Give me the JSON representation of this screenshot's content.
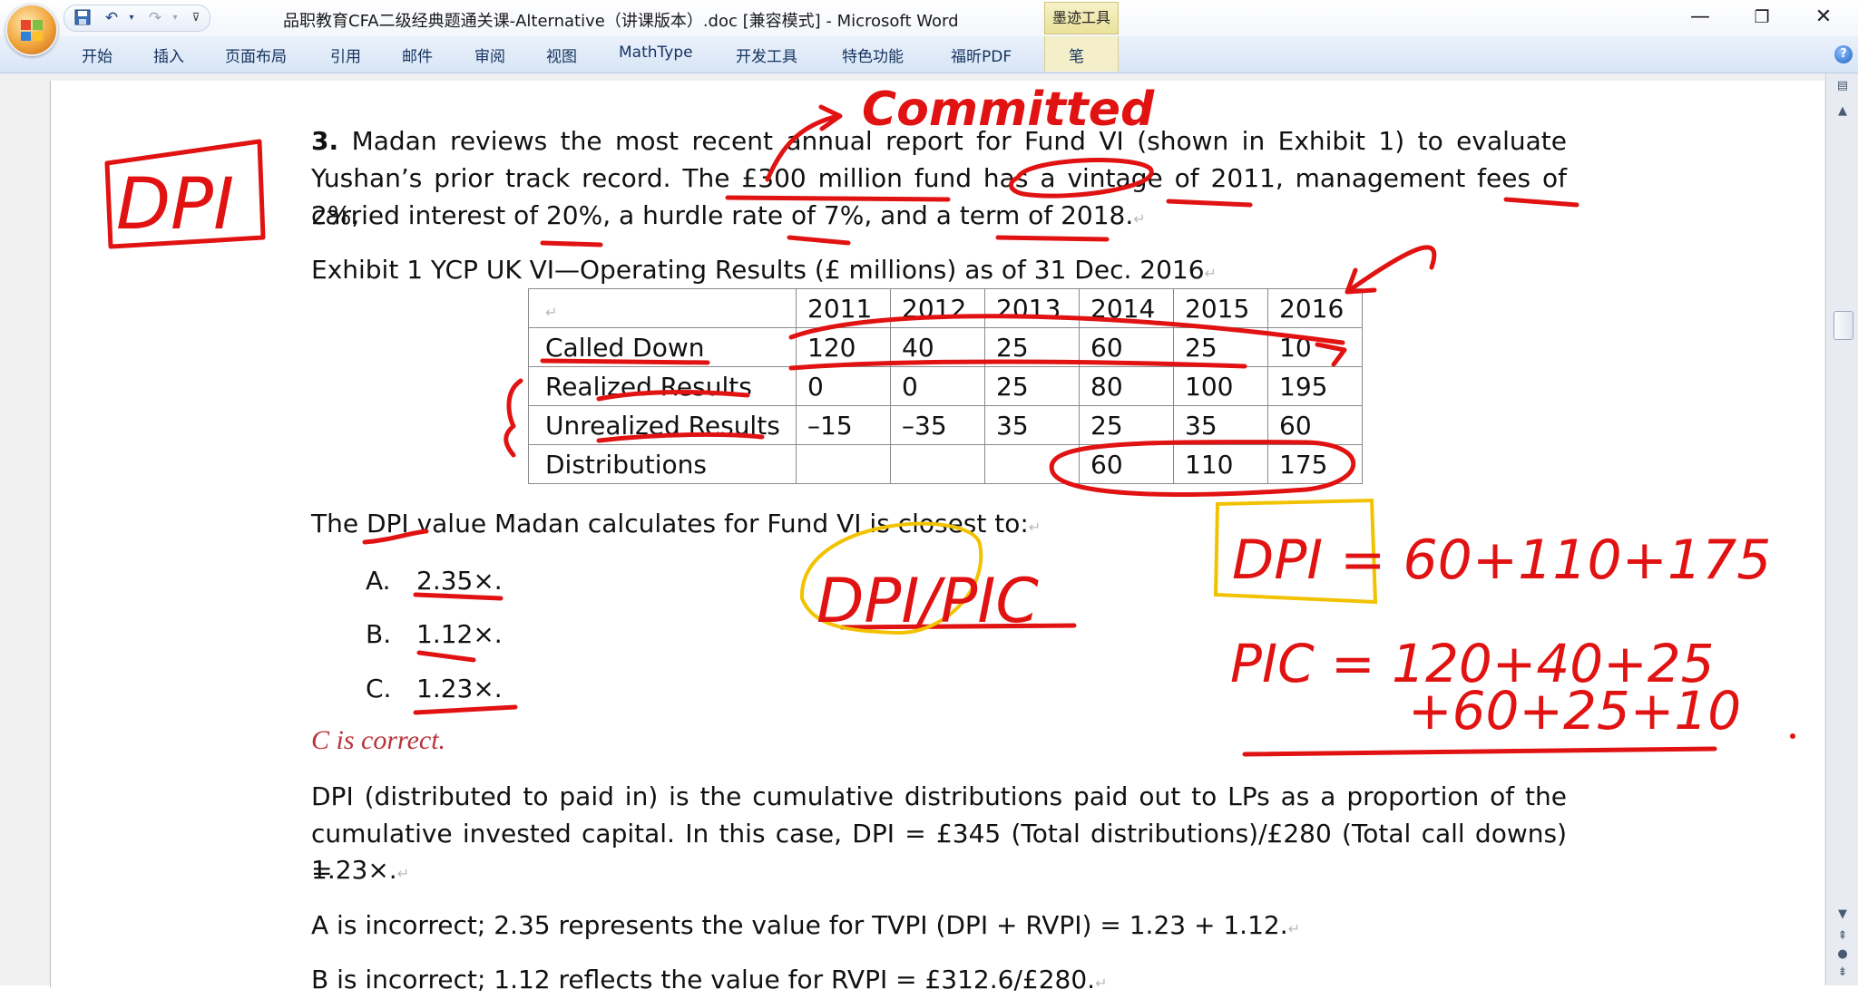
{
  "titlebar": {
    "document_title": "品职教育CFA二级经典题通关课-Alternative（讲课版本）.doc [兼容模式] - Microsoft Word",
    "contextual_tab_group": "墨迹工具",
    "icons": [
      "office-button-icon",
      "save-icon",
      "undo-icon",
      "redo-icon",
      "customize-qat-icon",
      "minimize-icon",
      "restore-icon",
      "close-icon"
    ]
  },
  "ribbon": {
    "tabs": [
      "开始",
      "插入",
      "页面布局",
      "引用",
      "邮件",
      "审阅",
      "视图",
      "MathType",
      "开发工具",
      "特色功能",
      "福昕PDF",
      "笔"
    ]
  },
  "document": {
    "question": {
      "number": "3.",
      "line1": "Madan reviews the most recent annual report for Fund VI (shown in Exhibit 1) to evaluate",
      "line2": "Yushan’s prior track record. The £300 million fund has a vintage of 2011, management fees of 2%,",
      "line3": "carried interest of 20%, a hurdle rate of 7%, and a term of 2018."
    },
    "exhibit_caption": "Exhibit 1 YCP UK VI—Operating Results (£ millions) as of 31 Dec. 2016",
    "exhibit_table": {
      "columns": [
        "",
        "2011",
        "2012",
        "2013",
        "2014",
        "2015",
        "2016"
      ],
      "rows": [
        {
          "label": "Called Down",
          "values": [
            "120",
            "40",
            "25",
            "60",
            "25",
            "10"
          ]
        },
        {
          "label": "Realized Results",
          "values": [
            "0",
            "0",
            "25",
            "80",
            "100",
            "195"
          ]
        },
        {
          "label": "Unrealized Results",
          "values": [
            "–15",
            "–35",
            "35",
            "25",
            "35",
            "60"
          ]
        },
        {
          "label": "Distributions",
          "values": [
            "",
            "",
            "",
            "60",
            "110",
            "175"
          ]
        }
      ]
    },
    "prompt": "The DPI value Madan calculates for Fund VI is closest to:",
    "options": [
      {
        "letter": "A.",
        "text": "2.35×."
      },
      {
        "letter": "B.",
        "text": "1.12×."
      },
      {
        "letter": "C.",
        "text": "1.23×."
      }
    ],
    "correct_label": "C is correct.",
    "explanation": {
      "line1": "DPI (distributed to paid in) is the cumulative distributions paid out to LPs as a proportion of the",
      "line2": "cumulative invested capital. In this case, DPI = £345 (Total distributions)/£280 (Total call downs) =",
      "line3": "1.23×.",
      "line4": "A is incorrect; 2.35 represents the value for TVPI (DPI + RVPI) = 1.23 + 1.12.",
      "line5": "B is incorrect; 1.12 reflects the value for RVPI = £312.6/£280."
    }
  },
  "handwriting": {
    "box_label": "DPI",
    "committed": "Committed",
    "ratio": "DPI/PIC",
    "dpi_formula": "DPI = 60+110+175",
    "pic_formula_1": "PIC = 120+40+25",
    "pic_formula_2": "+60+25+10",
    "ink_color": "#e11212",
    "highlight_color": "#f2c200"
  }
}
